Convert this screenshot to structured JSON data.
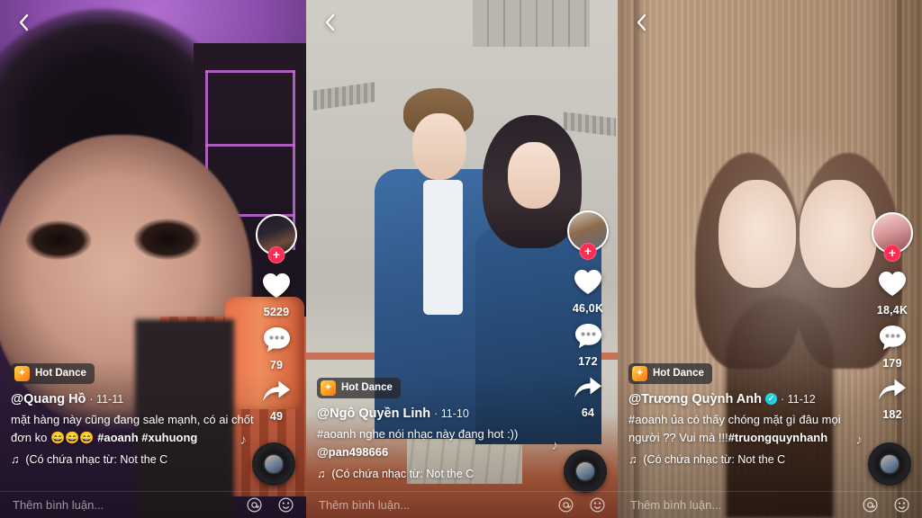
{
  "app": {
    "name": "TikTok video feed",
    "layout": "three side-by-side video panels"
  },
  "panels": [
    {
      "back_icon": "chevron-left-icon",
      "badge": {
        "icon": "sparkle-icon",
        "label": "Hot Dance"
      },
      "username": "@Quang Hồ",
      "verified": false,
      "date": "· 11-11",
      "description_line1": "mặt hàng này cũng đang  sale mạnh, có ai chốt",
      "description_line2": "đơn ko 😄😄😄 ",
      "hashtags": "#aoanh #xuhuong",
      "music_icon": "music-note-icon",
      "music_text": "(Có chứa nhạc từ: Not the C",
      "actions": {
        "avatar": "creator-avatar",
        "follow": "+",
        "like_icon": "heart-icon",
        "like_count": "5229",
        "comment_icon": "comment-bubble-icon",
        "comment_count": "79",
        "share_icon": "share-arrow-icon",
        "share_count": "49"
      },
      "comment_bar": {
        "placeholder": "Thêm bình luận...",
        "mention_icon": "at-sign-icon",
        "emoji_icon": "smiley-icon"
      }
    },
    {
      "back_icon": "chevron-left-icon",
      "badge": {
        "icon": "sparkle-icon",
        "label": "Hot Dance"
      },
      "username": "@Ngô Quyền Linh",
      "verified": false,
      "date": "· 11-10",
      "description_line1": "#aoanh nghe nói nhạc này đang hot :))",
      "description_line2": "@pan498666",
      "hashtags": "",
      "music_icon": "music-note-icon",
      "music_text": "(Có chứa nhạc từ: Not the C",
      "actions": {
        "avatar": "creator-avatar",
        "follow": "+",
        "like_icon": "heart-icon",
        "like_count": "46,0K",
        "comment_icon": "comment-bubble-icon",
        "comment_count": "172",
        "share_icon": "share-arrow-icon",
        "share_count": "64"
      },
      "comment_bar": {
        "placeholder": "Thêm bình luận...",
        "mention_icon": "at-sign-icon",
        "emoji_icon": "smiley-icon"
      }
    },
    {
      "back_icon": "chevron-left-icon",
      "badge": {
        "icon": "sparkle-icon",
        "label": "Hot Dance"
      },
      "username": "@Trương Quỳnh Anh",
      "verified": true,
      "verified_mark": "✓",
      "date": "· 11-12",
      "description_line1": "#aoanh ủa có thấy chóng mặt gì đâu mọi",
      "description_line2": "người ?? Vui mà !!!",
      "hashtags": "#truongquynhanh",
      "music_icon": "music-note-icon",
      "music_text": "(Có chứa nhạc từ: Not the C",
      "actions": {
        "avatar": "creator-avatar",
        "follow": "+",
        "like_icon": "heart-icon",
        "like_count": "18,4K",
        "comment_icon": "comment-bubble-icon",
        "comment_count": "179",
        "share_icon": "share-arrow-icon",
        "share_count": "182"
      },
      "comment_bar": {
        "placeholder": "Thêm bình luận...",
        "mention_icon": "at-sign-icon",
        "emoji_icon": "smiley-icon"
      }
    }
  ],
  "colors": {
    "accent_pink": "#fe2c55",
    "verified_blue": "#20d5ec",
    "badge_orange": "#ff9b21",
    "text_white": "#ffffff"
  }
}
